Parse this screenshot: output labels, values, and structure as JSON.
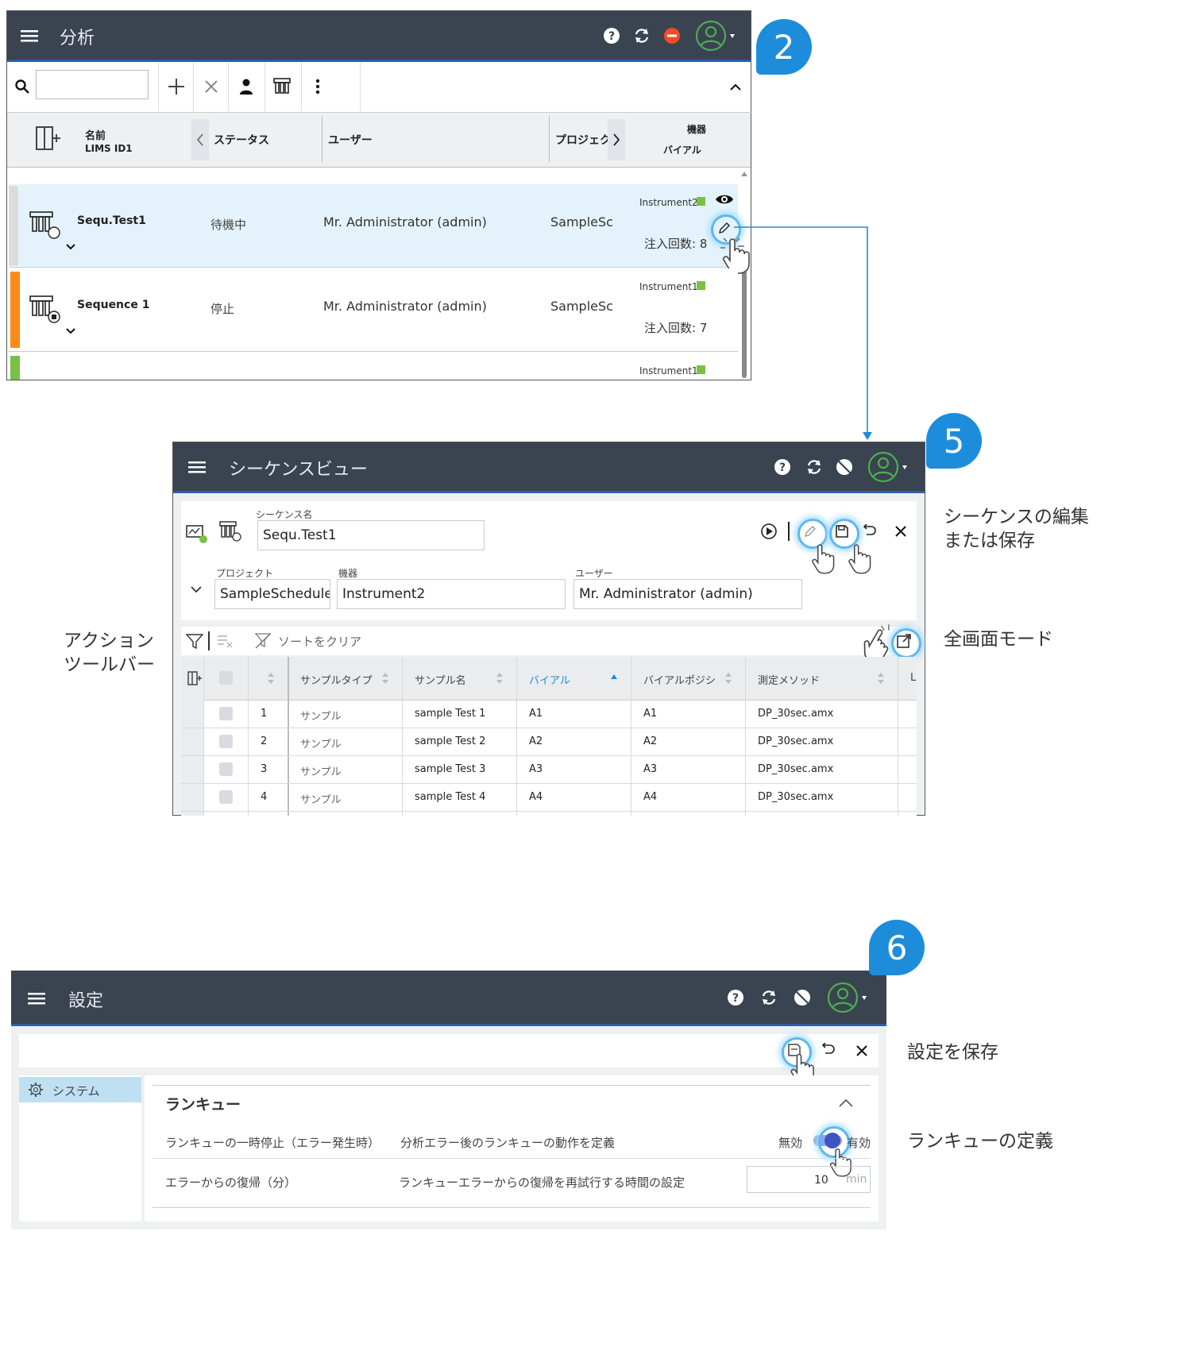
{
  "badges": [
    "2",
    "5",
    "6"
  ],
  "panel1": {
    "title": "分析",
    "columns": {
      "name": "名前",
      "lims": "LIMS ID1",
      "status": "ステータス",
      "user": "ユーザー",
      "project": "プロジェク",
      "instrument": "機器",
      "vial": "バイアル"
    },
    "rows": [
      {
        "name": "Sequ.Test1",
        "status": "待機中",
        "user": "Mr. Administrator (admin)",
        "project": "SampleSc",
        "instrument": "Instrument2",
        "injections": "注入回数: 8",
        "bar_color": "#dcdcdc"
      },
      {
        "name": "Sequence 1",
        "status": "停止",
        "user": "Mr. Administrator (admin)",
        "project": "SampleSc",
        "instrument": "Instrument1",
        "injections": "注入回数: 7",
        "bar_color": "#ff8a1a"
      },
      {
        "instrument": "Instrument1",
        "bar_color": "#7ac143"
      }
    ],
    "status_green": "#7ac143"
  },
  "panel2": {
    "title": "シーケンスビュー",
    "seq_label": "シーケンス名",
    "seq_value": "Sequ.Test1",
    "project_label": "プロジェクト",
    "project_value": "SampleScheduler (U",
    "instrument_label": "機器",
    "instrument_value": "Instrument2",
    "user_label": "ユーザー",
    "user_value": "Mr. Administrator (admin)",
    "clear_sort": "ソートをクリア",
    "headers": [
      "サンプルタイプ",
      "サンプル名",
      "バイアル",
      "バイアルポジシ",
      "測定メソッド",
      "L"
    ],
    "rows": [
      {
        "n": "1",
        "type": "サンプル",
        "name": "sample Test 1",
        "vial": "A1",
        "pos": "A1",
        "method": "DP_30sec.amx"
      },
      {
        "n": "2",
        "type": "サンプル",
        "name": "sample Test 2",
        "vial": "A2",
        "pos": "A2",
        "method": "DP_30sec.amx"
      },
      {
        "n": "3",
        "type": "サンプル",
        "name": "sample Test 3",
        "vial": "A3",
        "pos": "A3",
        "method": "DP_30sec.amx"
      },
      {
        "n": "4",
        "type": "サンプル",
        "name": "sample Test 4",
        "vial": "A4",
        "pos": "A4",
        "method": "DP_30sec.amx"
      }
    ]
  },
  "panel3": {
    "title": "設定",
    "nav_system": "システム",
    "section": "ランキュー",
    "row1_label": "ランキューの一時停止（エラー発生時）",
    "row1_desc": "分析エラー後のランキューの動作を定義",
    "toggle_off": "無効",
    "toggle_on": "有効",
    "row2_label": "エラーからの復帰（分）",
    "row2_desc": "ランキューエラーからの復帰を再試行する時間の設定",
    "row2_value": "10",
    "row2_unit": "min"
  },
  "callouts": {
    "edit_save": "シーケンスの編集\nまたは保存",
    "fullscreen": "全画面モード",
    "action_toolbar": "アクション\nツールバー",
    "save_settings": "設定を保存",
    "runqueue_def": "ランキューの定義"
  },
  "colors": {
    "accent": "#1d8ddb",
    "topbar": "#3a4350",
    "highlight": "#e4f3fb",
    "toggle": "#3b56c4"
  }
}
